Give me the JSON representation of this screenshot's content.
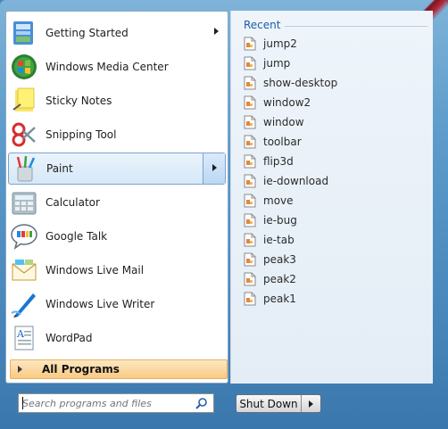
{
  "start_menu": {
    "programs": [
      {
        "label": "Getting Started",
        "icon": "getting-started-icon",
        "has_arrow": true
      },
      {
        "label": "Windows Media Center",
        "icon": "windows-media-center-icon",
        "has_arrow": false
      },
      {
        "label": "Sticky Notes",
        "icon": "sticky-notes-icon",
        "has_arrow": false
      },
      {
        "label": "Snipping Tool",
        "icon": "snipping-tool-icon",
        "has_arrow": false
      },
      {
        "label": "Paint",
        "icon": "paint-icon",
        "has_arrow": true,
        "selected": true
      },
      {
        "label": "Calculator",
        "icon": "calculator-icon",
        "has_arrow": false
      },
      {
        "label": "Google Talk",
        "icon": "google-talk-icon",
        "has_arrow": false
      },
      {
        "label": "Windows Live Mail",
        "icon": "windows-live-mail-icon",
        "has_arrow": false
      },
      {
        "label": "Windows Live Writer",
        "icon": "windows-live-writer-icon",
        "has_arrow": false
      },
      {
        "label": "WordPad",
        "icon": "wordpad-icon",
        "has_arrow": false
      }
    ],
    "all_programs_label": "All Programs",
    "recent": {
      "title": "Recent",
      "items": [
        "jump2",
        "jump",
        "show-desktop",
        "window2",
        "window",
        "toolbar",
        "flip3d",
        "ie-download",
        "move",
        "ie-bug",
        "ie-tab",
        "peak3",
        "peak2",
        "peak1"
      ]
    },
    "search": {
      "placeholder": "Search programs and files"
    },
    "shutdown_label": "Shut Down"
  },
  "colors": {
    "accent": "#1d5ca8",
    "selection": "#d6e8f8",
    "all_programs": "#f9c982"
  }
}
